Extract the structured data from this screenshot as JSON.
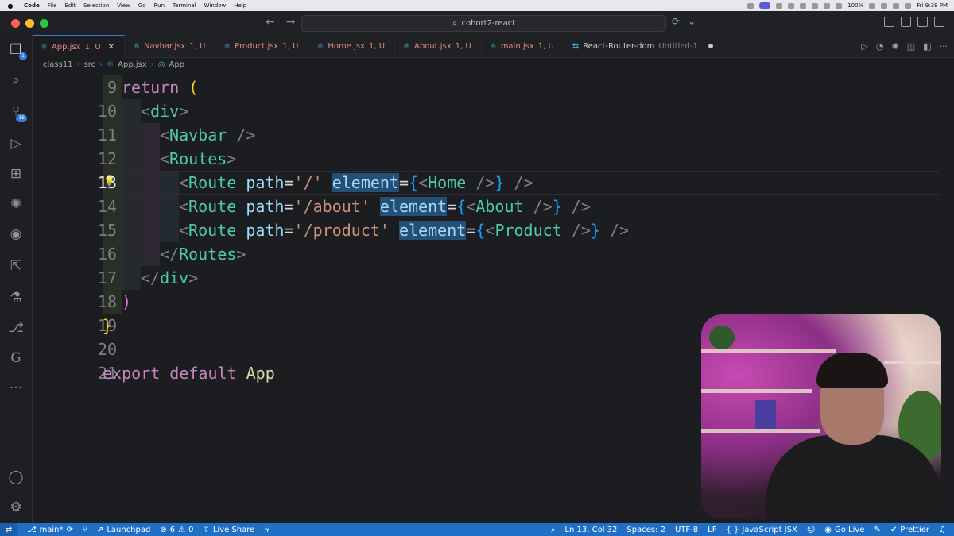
{
  "menubar": {
    "items": [
      "Code",
      "File",
      "Edit",
      "Selection",
      "View",
      "Go",
      "Run",
      "Terminal",
      "Window",
      "Help"
    ],
    "battery": "100%",
    "clock": "Fri 9:38 PM"
  },
  "titlebar": {
    "search_text": "cohort2-react"
  },
  "tabs": [
    {
      "name": "App.jsx",
      "meta": "1, U",
      "active": true
    },
    {
      "name": "Navbar.jsx",
      "meta": "1, U"
    },
    {
      "name": "Product.jsx",
      "meta": "1, U"
    },
    {
      "name": "Home.jsx",
      "meta": "1, U"
    },
    {
      "name": "About.jsx",
      "meta": "1, U"
    },
    {
      "name": "main.jsx",
      "meta": "1, U"
    },
    {
      "name": "React-Router-dom",
      "meta": "Untitled-1"
    }
  ],
  "breadcrumb": {
    "folder": "class11",
    "src": "src",
    "file": "App.jsx",
    "symbol": "App"
  },
  "activity": {
    "explorer_badge": "1",
    "scm_badge": "16"
  },
  "code": {
    "lines": [
      "9",
      "10",
      "11",
      "12",
      "13",
      "14",
      "15",
      "16",
      "17",
      "18",
      "19",
      "20",
      "21"
    ],
    "current_line": "13",
    "t_return": "return",
    "t_paren_open": "(",
    "t_paren_close": ")",
    "t_brace_close": "}",
    "t_lt": "<",
    "t_gt": ">",
    "t_lt_slash": "</",
    "t_self_close": "/>",
    "t_div": "div",
    "t_navbar": "Navbar",
    "t_routes": "Routes",
    "t_route": "Route",
    "t_path": "path",
    "t_element": "element",
    "t_eq": "=",
    "t_brace_open": "{",
    "p1": "'/'",
    "p2": "'/about'",
    "p3": "'/product'",
    "c1": "Home",
    "c2": "About",
    "c3": "Product",
    "t_export": "export",
    "t_default": "default",
    "t_app": "App"
  },
  "status": {
    "branch": "main*",
    "launchpad": "Launchpad",
    "errors": "6",
    "warnings": "0",
    "liveshare": "Live Share",
    "position": "Ln 13, Col 32",
    "spaces": "Spaces: 2",
    "encoding": "UTF-8",
    "eol": "LF",
    "language": "JavaScript JSX",
    "golive": "Go Live",
    "prettier": "Prettier"
  },
  "colors": {
    "accent": "#1f6fc7",
    "tab_modified": "#e2887c",
    "jsx_tag": "#4ec9b0",
    "attribute": "#9cdcfe",
    "string": "#ce9178",
    "keyword": "#c586c0"
  }
}
